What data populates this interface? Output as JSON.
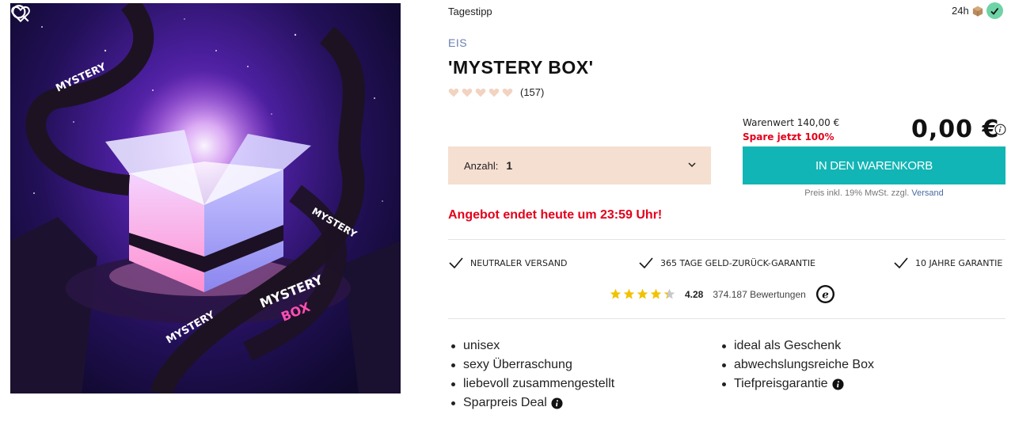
{
  "header": {
    "tag": "Tagestipp",
    "delivery_label": "24h"
  },
  "product": {
    "brand": "EIS",
    "title": "'MYSTERY BOX'",
    "rating_count": "(157)",
    "hearts_filled": 5,
    "image_alt_text_on_ribbon": "MYSTERY BOX"
  },
  "pricing": {
    "retail_value": "Warenwert 140,00 €",
    "saving": "Spare jetzt 100%",
    "price": "0,00 €",
    "note_prefix": "Preis inkl. 19% MwSt. zzgl.",
    "note_link": "Versand"
  },
  "purchase": {
    "quantity_label": "Anzahl:",
    "quantity_value": "1",
    "cart_button": "In den Warenkorb"
  },
  "offer": "Angebot endet heute um 23:59 Uhr!",
  "usps": [
    "NEUTRALER VERSAND",
    "365 TAGE GELD-ZURÜCK-GARANTIE",
    "10 JAHRE GARANTIE"
  ],
  "trust": {
    "score": "4.28",
    "stars": 4.28,
    "reviews": "374.187 Bewertungen"
  },
  "features_left": [
    "unisex",
    "sexy Überraschung",
    "liebevoll zusammengestellt",
    "Sparpreis Deal"
  ],
  "features_right": [
    "ideal als Geschenk",
    "abwechslungsreiche Box",
    "Tiefpreisgarantie"
  ],
  "colors": {
    "accent_teal": "#12b5b5",
    "sale_red": "#e3001b",
    "brand_blue": "#6a7fb0",
    "qty_bg": "#f5dfd1",
    "check_green": "#6fd3a6",
    "star_yellow": "#f2c200"
  }
}
